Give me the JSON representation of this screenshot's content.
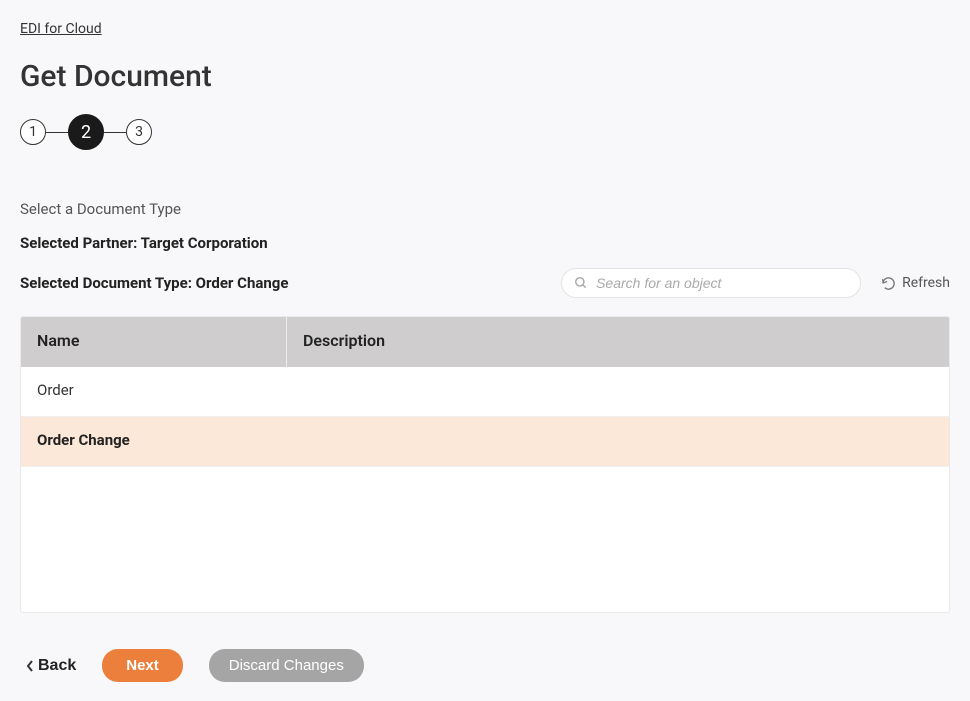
{
  "breadcrumb": "EDI for Cloud",
  "page_title": "Get Document",
  "steps": [
    "1",
    "2",
    "3"
  ],
  "active_step_index": 1,
  "section_label": "Select a Document Type",
  "selected_partner_label": "Selected Partner: Target Corporation",
  "selected_doctype_label": "Selected Document Type: Order Change",
  "search": {
    "placeholder": "Search for an object"
  },
  "refresh_label": "Refresh",
  "table": {
    "headers": {
      "name": "Name",
      "description": "Description"
    },
    "rows": [
      {
        "name": "Order",
        "description": "",
        "selected": false
      },
      {
        "name": "Order Change",
        "description": "",
        "selected": true
      }
    ]
  },
  "buttons": {
    "back": "Back",
    "next": "Next",
    "discard": "Discard Changes"
  }
}
